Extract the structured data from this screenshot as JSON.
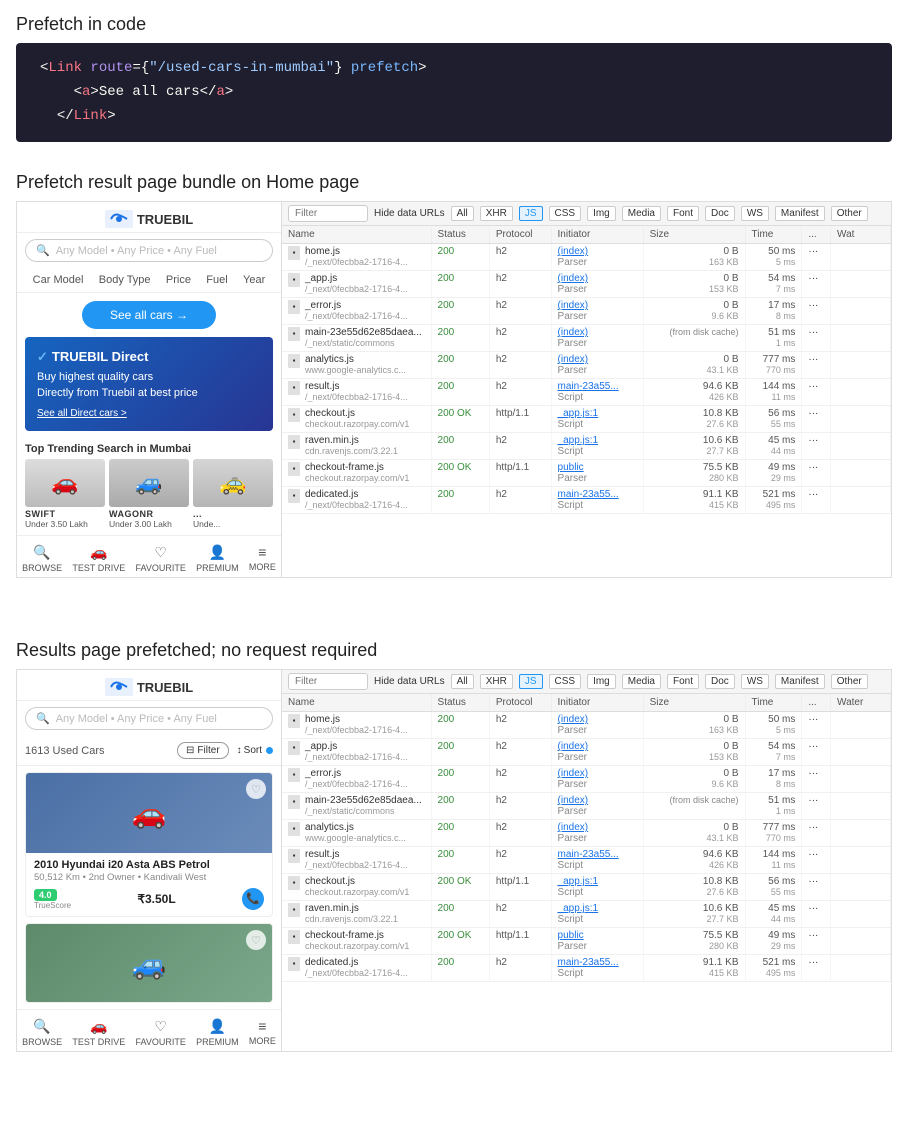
{
  "sections": {
    "prefetch_code": {
      "title": "Prefetch in code",
      "code_lines": [
        {
          "content": "<Link route={\"/used-cars-in-mumbai\"} prefetch>",
          "type": "tag"
        },
        {
          "content": "  <a>See all cars</a>",
          "type": "inner"
        },
        {
          "content": "</Link>",
          "type": "close"
        }
      ]
    },
    "prefetch_result": {
      "title": "Prefetch result page bundle on Home page"
    },
    "results_prefetched": {
      "title": "Results page prefetched; no request required"
    }
  },
  "browser": {
    "logo": "TRUEBIL",
    "search_placeholder": "Any Model • Any Price • Any Fuel",
    "filter_items": [
      "Car Model",
      "Body Type",
      "Price",
      "Fuel",
      "Year"
    ],
    "see_all_btn": "See all cars →",
    "truebil_direct": {
      "brand": "TRUEBIL Direct",
      "tagline": "Buy highest quality cars",
      "sub": "Directly from Truebil at best price",
      "link": "See all Direct cars >"
    },
    "trending_title": "Top Trending Search in Mumbai",
    "cars": [
      {
        "brand": "SWIFT",
        "price": "Under 3.50 Lakh"
      },
      {
        "brand": "WAGONR",
        "price": "Under 3.00 Lakh"
      },
      {
        "brand": "...",
        "price": "Unde..."
      }
    ],
    "bottom_nav": [
      {
        "icon": "🔍",
        "label": "BROWSE"
      },
      {
        "icon": "🚗",
        "label": "TEST DRIVE"
      },
      {
        "icon": "♡",
        "label": "FAVOURITE"
      },
      {
        "icon": "👤",
        "label": "PREMIUM"
      },
      {
        "icon": "≡",
        "label": "MORE"
      }
    ]
  },
  "results_browser": {
    "logo": "TRUEBIL",
    "search_placeholder": "Any Model • Any Price • Any Fuel",
    "count": "1613 Used Cars",
    "filter_btn": "Filter",
    "sort_btn": "↕ Sort",
    "car_listing": {
      "title": "2010 Hyundai i20 Asta ABS Petrol",
      "km": "50,512 Km",
      "owner": "2nd Owner",
      "location": "Kandivali West",
      "truescore": "4.0",
      "truescore_label": "TrueScore",
      "price": "₹3.50L"
    }
  },
  "network_panel_top": {
    "filter_placeholder": "Filter",
    "filters": [
      "Hide data URLs",
      "All",
      "XHR",
      "JS",
      "CSS",
      "Img",
      "Media",
      "Font",
      "Doc",
      "WS",
      "Manifest",
      "Other"
    ],
    "active_filter": "JS",
    "columns": [
      "Name",
      "Status",
      "Protocol",
      "Initiator",
      "Size",
      "Time",
      "...",
      "Wat"
    ],
    "rows": [
      {
        "name": "home.js",
        "path": "/_next/0fecbba2-1716-4...",
        "status": "200",
        "protocol": "h2",
        "initiator": "(index)",
        "initiator_type": "Parser",
        "size": "0 B",
        "size2": "163 KB",
        "time1": "50 ms",
        "time2": "5 ms"
      },
      {
        "name": "_app.js",
        "path": "/_next/0fecbba2-1716-4...",
        "status": "200",
        "protocol": "h2",
        "initiator": "(index)",
        "initiator_type": "Parser",
        "size": "0 B",
        "size2": "153 KB",
        "time1": "54 ms",
        "time2": "7 ms"
      },
      {
        "name": "_error.js",
        "path": "/_next/0fecbba2-1716-4...",
        "status": "200",
        "protocol": "h2",
        "initiator": "(index)",
        "initiator_type": "Parser",
        "size": "0 B",
        "size2": "9.6 KB",
        "time1": "17 ms",
        "time2": "8 ms"
      },
      {
        "name": "main-23e55d62e85daea...",
        "path": "/_next/static/commons",
        "status": "200",
        "protocol": "h2",
        "initiator": "(index)",
        "initiator_type": "Parser",
        "size": "(from disk cache)",
        "size2": "",
        "time1": "51 ms",
        "time2": "1 ms"
      },
      {
        "name": "analytics.js",
        "path": "www.google-analytics.c...",
        "status": "200",
        "protocol": "h2",
        "initiator": "(index)",
        "initiator_type": "Parser",
        "size": "0 B",
        "size2": "43.1 KB",
        "time1": "777 ms",
        "time2": "770 ms"
      },
      {
        "name": "result.js",
        "path": "/_next/0fecbba2-1716-4...",
        "status": "200",
        "protocol": "h2",
        "initiator": "main-23a55...",
        "initiator_type": "Script",
        "size": "94.6 KB",
        "size2": "426 KB",
        "time1": "144 ms",
        "time2": "11 ms"
      },
      {
        "name": "checkout.js",
        "path": "checkout.razorpay.com/v1",
        "status": "200",
        "protocol": "http/1.1",
        "status2": "OK",
        "initiator": "_app.js:1",
        "initiator_type": "Script",
        "size": "10.8 KB",
        "size2": "27.6 KB",
        "time1": "56 ms",
        "time2": "55 ms"
      },
      {
        "name": "raven.min.js",
        "path": "cdn.ravenjs.com/3.22.1",
        "status": "200",
        "protocol": "h2",
        "initiator": "_app.js:1",
        "initiator_type": "Script",
        "size": "10.6 KB",
        "size2": "27.7 KB",
        "time1": "45 ms",
        "time2": "44 ms"
      },
      {
        "name": "checkout-frame.js",
        "path": "checkout.razorpay.com/v1",
        "status": "200",
        "protocol": "http/1.1",
        "status2": "OK",
        "initiator": "public",
        "initiator_type": "Parser",
        "size": "75.5 KB",
        "size2": "280 KB",
        "time1": "49 ms",
        "time2": "29 ms"
      },
      {
        "name": "dedicated.js",
        "path": "/_next/0fecbba2-1716-4...",
        "status": "200",
        "protocol": "h2",
        "initiator": "main-23a55...",
        "initiator_type": "Script",
        "size": "91.1 KB",
        "size2": "415 KB",
        "time1": "521 ms",
        "time2": "495 ms"
      }
    ]
  },
  "network_panel_bottom": {
    "filter_placeholder": "Filter",
    "filters": [
      "Hide data URLs",
      "All",
      "XHR",
      "JS",
      "CSS",
      "Img",
      "Media",
      "Font",
      "Doc",
      "WS",
      "Manifest",
      "Other"
    ],
    "active_filter": "JS",
    "columns": [
      "Name",
      "Status",
      "Protocol",
      "Initiator",
      "Size",
      "Time",
      "...",
      "Water"
    ],
    "rows": [
      {
        "name": "home.js",
        "path": "/_next/0fecbba2-1716-4...",
        "status": "200",
        "protocol": "h2",
        "initiator": "(index)",
        "initiator_type": "Parser",
        "size": "0 B",
        "size2": "163 KB",
        "time1": "50 ms",
        "time2": "5 ms"
      },
      {
        "name": "_app.js",
        "path": "/_next/0fecbba2-1716-4...",
        "status": "200",
        "protocol": "h2",
        "initiator": "(index)",
        "initiator_type": "Parser",
        "size": "0 B",
        "size2": "153 KB",
        "time1": "54 ms",
        "time2": "7 ms"
      },
      {
        "name": "_error.js",
        "path": "/_next/0fecbba2-1716-4...",
        "status": "200",
        "protocol": "h2",
        "initiator": "(index)",
        "initiator_type": "Parser",
        "size": "0 B",
        "size2": "9.6 KB",
        "time1": "17 ms",
        "time2": "8 ms"
      },
      {
        "name": "main-23e55d62e85daea...",
        "path": "/_next/static/commons",
        "status": "200",
        "protocol": "h2",
        "initiator": "(index)",
        "initiator_type": "Parser",
        "size": "(from disk cache)",
        "size2": "",
        "time1": "51 ms",
        "time2": "1 ms"
      },
      {
        "name": "analytics.js",
        "path": "www.google-analytics.c...",
        "status": "200",
        "protocol": "h2",
        "initiator": "(index)",
        "initiator_type": "Parser",
        "size": "0 B",
        "size2": "43.1 KB",
        "time1": "777 ms",
        "time2": "770 ms"
      },
      {
        "name": "result.js",
        "path": "/_next/0fecbba2-1716-4...",
        "status": "200",
        "protocol": "h2",
        "initiator": "main-23a55...",
        "initiator_type": "Script",
        "size": "94.6 KB",
        "size2": "426 KB",
        "time1": "144 ms",
        "time2": "11 ms"
      },
      {
        "name": "checkout.js",
        "path": "checkout.razorpay.com/v1",
        "status": "200",
        "protocol": "http/1.1",
        "status2": "OK",
        "initiator": "_app.js:1",
        "initiator_type": "Script",
        "size": "10.8 KB",
        "size2": "27.6 KB",
        "time1": "56 ms",
        "time2": "55 ms"
      },
      {
        "name": "raven.min.js",
        "path": "cdn.ravenjs.com/3.22.1",
        "status": "200",
        "protocol": "h2",
        "initiator": "_app.js:1",
        "initiator_type": "Script",
        "size": "10.6 KB",
        "size2": "27.7 KB",
        "time1": "45 ms",
        "time2": "44 ms"
      },
      {
        "name": "checkout-frame.js",
        "path": "checkout.razorpay.com/v1",
        "status": "200",
        "protocol": "http/1.1",
        "status2": "OK",
        "initiator": "public",
        "initiator_type": "Parser",
        "size": "75.5 KB",
        "size2": "280 KB",
        "time1": "49 ms",
        "time2": "29 ms"
      },
      {
        "name": "dedicated.js",
        "path": "/_next/0fecbba2-1716-4...",
        "status": "200",
        "protocol": "h2",
        "initiator": "main-23a55...",
        "initiator_type": "Script",
        "size": "91.1 KB",
        "size2": "415 KB",
        "time1": "521 ms",
        "time2": "495 ms"
      }
    ]
  }
}
